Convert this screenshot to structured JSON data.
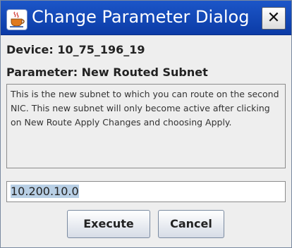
{
  "window": {
    "title": "Change Parameter Dialog",
    "icon": "java-coffee-cup-icon",
    "close_label": "✕"
  },
  "device": {
    "label": "Device: 10_75_196_19"
  },
  "parameter": {
    "label": "Parameter: New Routed Subnet",
    "description": "This is the new subnet to which you can route on the second NIC.   This new subnet will only become active after clicking on New Route Apply Changes and choosing Apply."
  },
  "input": {
    "value": "10.200.10.0",
    "selected": true
  },
  "buttons": {
    "execute_label": "Execute",
    "cancel_label": "Cancel"
  },
  "colors": {
    "titlebar": "#0b3ba6",
    "dialog_background": "#eeeeee",
    "selection": "#b8cfe5"
  }
}
